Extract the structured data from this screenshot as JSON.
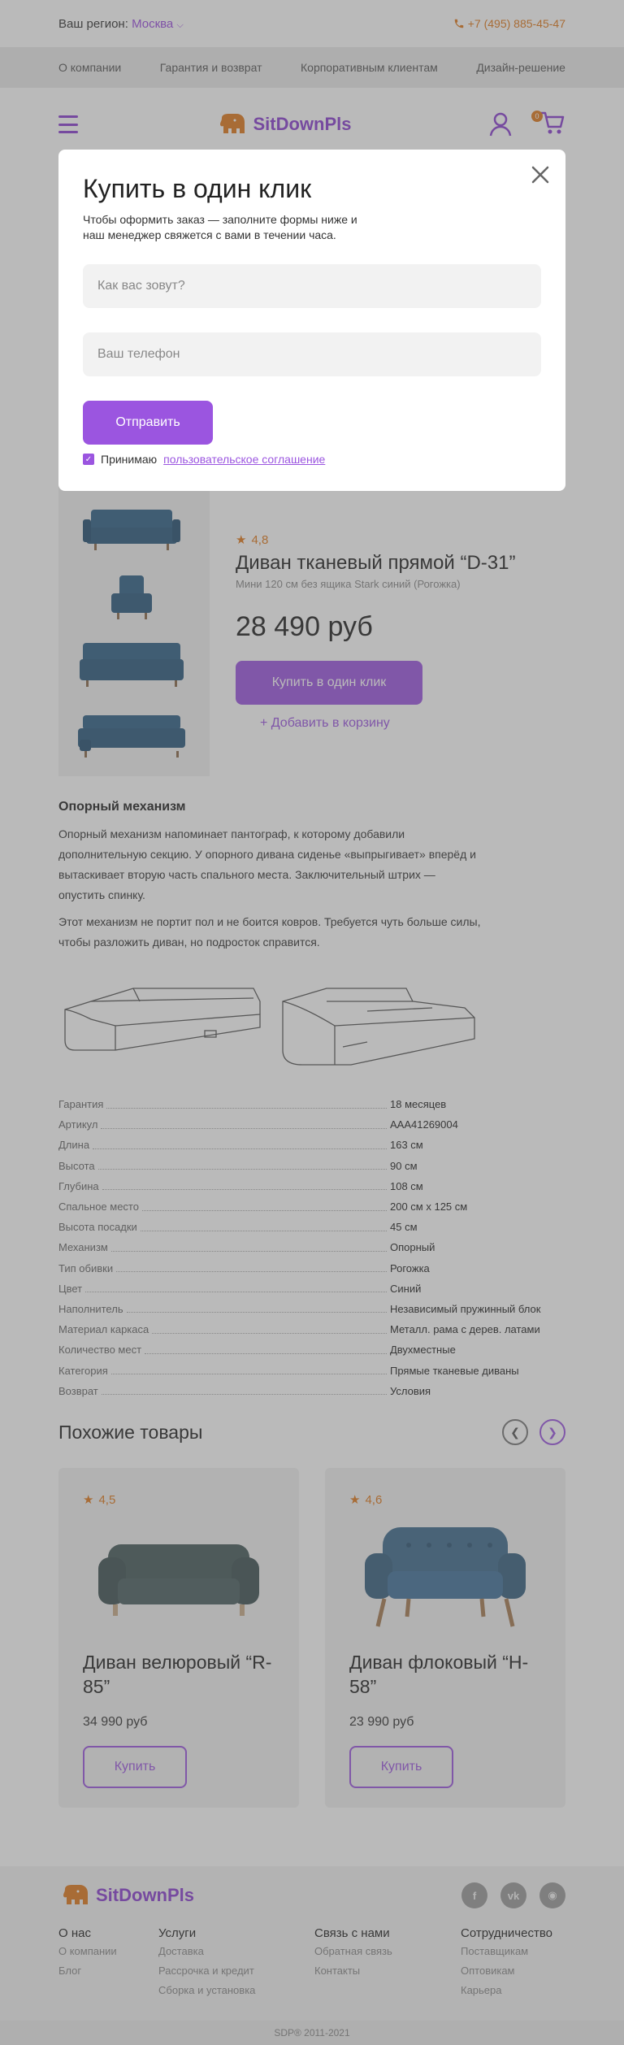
{
  "topbar": {
    "region_label": "Ваш регион:",
    "region_city": "Москва",
    "phone": "+7 (495) 885-45-47"
  },
  "nav": [
    "О компании",
    "Гарантия и возврат",
    "Корпоративным клиентам",
    "Дизайн-решение"
  ],
  "brand": {
    "name": "SitDownPls",
    "accent": "#9b55e0",
    "orange": "#e0791c"
  },
  "header": {
    "cart_count": "0"
  },
  "product": {
    "rating": "4,8",
    "title": "Диван тканевый прямой “D-31”",
    "subtitle": "Мини 120 см без ящика Stark синий (Рогожка)",
    "price": "28 490 руб",
    "buy_one_click": "Купить в один клик",
    "add_to_cart": "+ Добавить в корзину"
  },
  "description": {
    "title": "Опорный механизм",
    "p1": "Опорный механизм напоминает пантограф, к которому добавили дополнительную секцию. У опорного дивана сиденье «выпрыгивает» вперёд и вытаскивает вторую часть спального места. Заключительный штрих — опустить спинку.",
    "p2": "Этот механизм не портит пол и не боится ковров. Требуется чуть больше силы, чтобы разложить диван, но подросток справится."
  },
  "specs": [
    {
      "name": "Гарантия",
      "value": "18 месяцев"
    },
    {
      "name": "Артикул",
      "value": "AAA41269004"
    },
    {
      "name": "Длина",
      "value": "163 см"
    },
    {
      "name": "Высота",
      "value": "90 см"
    },
    {
      "name": "Глубина",
      "value": "108 см"
    },
    {
      "name": "Спальное место",
      "value": "200 см х 125 см"
    },
    {
      "name": "Высота посадки",
      "value": "45 см"
    },
    {
      "name": "Механизм",
      "value": "Опорный"
    },
    {
      "name": "Тип обивки",
      "value": "Рогожка"
    },
    {
      "name": "Цвет",
      "value": "Синий"
    },
    {
      "name": "Наполнитель",
      "value": "Независимый пружинный блок"
    },
    {
      "name": "Материал каркаса",
      "value": "Металл. рама с дерев. латами"
    },
    {
      "name": "Количество мест",
      "value": "Двухместные"
    },
    {
      "name": "Категория",
      "value": "Прямые тканевые диваны"
    },
    {
      "name": "Возврат",
      "value": "Условия"
    }
  ],
  "similar": {
    "title": "Похожие товары",
    "items": [
      {
        "rating": "4,5",
        "title": "Диван велюровый “R-85”",
        "price": "34 990 руб",
        "buy": "Купить"
      },
      {
        "rating": "4,6",
        "title": "Диван флоковый “H-58”",
        "price": "23 990 руб",
        "buy": "Купить"
      }
    ]
  },
  "footer": {
    "columns": [
      {
        "title": "О нас",
        "links": [
          "О компании",
          "Блог"
        ]
      },
      {
        "title": "Услуги",
        "links": [
          "Доставка",
          "Рассрочка и кредит",
          "Сборка и установка"
        ]
      },
      {
        "title": "Связь с нами",
        "links": [
          "Обратная связь",
          "Контакты"
        ]
      },
      {
        "title": "Сотрудничество",
        "links": [
          "Поставщикам",
          "Оптовикам",
          "Карьера"
        ]
      }
    ],
    "copyright": "SDP®   2011-2021"
  },
  "modal": {
    "title": "Купить в один клик",
    "subtitle": "Чтобы оформить заказ — заполните формы ниже и наш менеджер свяжется с вами в течении часа.",
    "name_placeholder": "Как вас зовут?",
    "phone_placeholder": "Ваш телефон",
    "submit": "Отправить",
    "agree_text": "Принимаю",
    "agree_link": "пользовательское соглашение"
  }
}
